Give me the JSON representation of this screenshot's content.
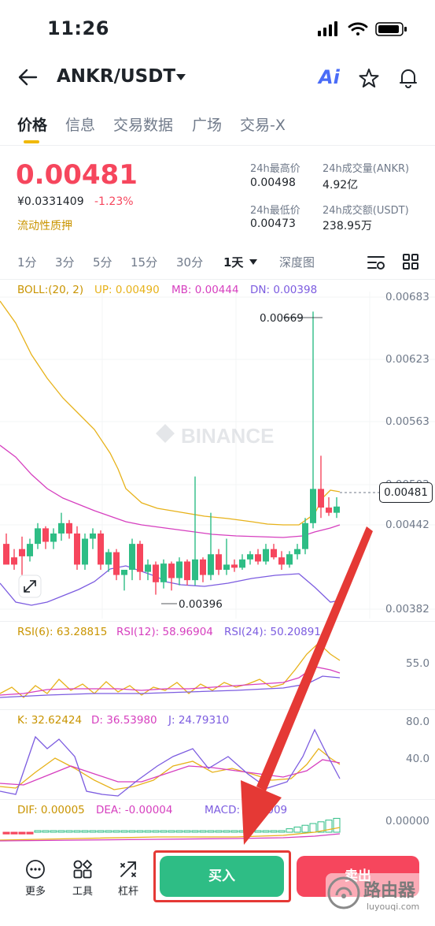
{
  "status": {
    "time": "11:26"
  },
  "header": {
    "pair": "ANKR/USDT",
    "ai_label": "Ai"
  },
  "tabs": [
    "价格",
    "信息",
    "交易数据",
    "广场",
    "交易-X"
  ],
  "price": {
    "last": "0.00481",
    "cny": "¥0.0331409",
    "change": "-1.23%",
    "tag": "流动性质押"
  },
  "stats": {
    "high_label": "24h最高价",
    "high": "0.00498",
    "low_label": "24h最低价",
    "low": "0.00473",
    "vol_label": "24h成交量(ANKR)",
    "vol": "4.92亿",
    "amt_label": "24h成交额(USDT)",
    "amt": "238.95万"
  },
  "intervals": [
    "1分",
    "3分",
    "5分",
    "15分",
    "30分",
    "1天",
    "深度图"
  ],
  "indicators": {
    "boll": "BOLL:(20, 2)",
    "up": "UP: 0.00490",
    "mb": "MB: 0.00444",
    "dn": "DN: 0.00398",
    "rsi6": "RSI(6): 63.28815",
    "rsi12": "RSI(12): 58.96904",
    "rsi24": "RSI(24): 50.20891",
    "k": "K: 32.62424",
    "d": "D: 36.53980",
    "j": "J: 24.79310",
    "dif": "DIF: 0.00005",
    "dea": "DEA: -0.00004",
    "macd": "MACD: 0.00009"
  },
  "price_axis": [
    "0.00683",
    "0.00623",
    "0.00563",
    "0.00502",
    "0.00442",
    "0.00382"
  ],
  "rsi_axis": [
    "55.0"
  ],
  "kdj_axis": [
    "80.0",
    "40.0"
  ],
  "macd_axis": [
    "0.00000"
  ],
  "annotations": {
    "high": "0.00669",
    "low": "0.00396",
    "current": "0.00481"
  },
  "watermark": "BINANCE",
  "bottom": {
    "more": "更多",
    "tools": "工具",
    "leverage": "杠杆",
    "buy": "买入",
    "sell": "卖出"
  },
  "corner_watermark": "路由器",
  "corner_sub": "luyouqi.com",
  "colors": {
    "up": "#2ebd85",
    "down": "#f6465d",
    "accent": "#f0b90b",
    "annotation_arrow": "#e53935"
  },
  "chart_data": {
    "type": "candlestick",
    "ohlc": [
      [
        0.00445,
        0.00455,
        0.00432,
        0.00425
      ],
      [
        0.00432,
        0.0044,
        0.0042,
        0.00425
      ],
      [
        0.0044,
        0.00452,
        0.00415,
        0.00433
      ],
      [
        0.00433,
        0.0045,
        0.00428,
        0.00445
      ],
      [
        0.00445,
        0.00465,
        0.0044,
        0.0046
      ],
      [
        0.0046,
        0.00462,
        0.0044,
        0.00447
      ],
      [
        0.00447,
        0.0046,
        0.0044,
        0.00455
      ],
      [
        0.00455,
        0.00475,
        0.00448,
        0.00465
      ],
      [
        0.00465,
        0.00468,
        0.0045,
        0.00455
      ],
      [
        0.00455,
        0.00462,
        0.0042,
        0.00425
      ],
      [
        0.00425,
        0.00455,
        0.0042,
        0.0045
      ],
      [
        0.0045,
        0.0046,
        0.0044,
        0.00455
      ],
      [
        0.00455,
        0.00458,
        0.0042,
        0.00425
      ],
      [
        0.00425,
        0.0044,
        0.00418,
        0.00437
      ],
      [
        0.00437,
        0.0044,
        0.0041,
        0.00415
      ],
      [
        0.00415,
        0.0042,
        0.004,
        0.0042
      ],
      [
        0.0042,
        0.0045,
        0.0041,
        0.00445
      ],
      [
        0.00445,
        0.00448,
        0.0041,
        0.00418
      ],
      [
        0.00418,
        0.0043,
        0.0041,
        0.00425
      ],
      [
        0.00425,
        0.00428,
        0.00396,
        0.00408
      ],
      [
        0.00408,
        0.0043,
        0.00402,
        0.00426
      ],
      [
        0.00426,
        0.00428,
        0.004,
        0.00412
      ],
      [
        0.00412,
        0.00432,
        0.00405,
        0.00428
      ],
      [
        0.00428,
        0.0043,
        0.00405,
        0.0041
      ],
      [
        0.0041,
        0.0051,
        0.00405,
        0.0043
      ],
      [
        0.0043,
        0.00432,
        0.00408,
        0.00415
      ],
      [
        0.00415,
        0.00475,
        0.0041,
        0.00435
      ],
      [
        0.00435,
        0.0044,
        0.00415,
        0.0042
      ],
      [
        0.0042,
        0.0045,
        0.00415,
        0.00425
      ],
      [
        0.00425,
        0.0043,
        0.00418,
        0.00422
      ],
      [
        0.00422,
        0.00435,
        0.0042,
        0.0043
      ],
      [
        0.0043,
        0.00438,
        0.00425,
        0.00435
      ],
      [
        0.00435,
        0.0044,
        0.00425,
        0.00428
      ],
      [
        0.00428,
        0.00445,
        0.00425,
        0.0044
      ],
      [
        0.0044,
        0.00445,
        0.0043,
        0.00432
      ],
      [
        0.00432,
        0.00438,
        0.0042,
        0.00425
      ],
      [
        0.00425,
        0.00438,
        0.00422,
        0.00435
      ],
      [
        0.00435,
        0.00445,
        0.0043,
        0.0044
      ],
      [
        0.0044,
        0.0047,
        0.00435,
        0.00465
      ],
      [
        0.00465,
        0.00669,
        0.0046,
        0.00498
      ],
      [
        0.00498,
        0.0053,
        0.0047,
        0.0048
      ],
      [
        0.0048,
        0.0049,
        0.00472,
        0.00475
      ],
      [
        0.00475,
        0.0049,
        0.0047,
        0.00481
      ]
    ],
    "ylim": [
      0.00382,
      0.00683
    ]
  }
}
